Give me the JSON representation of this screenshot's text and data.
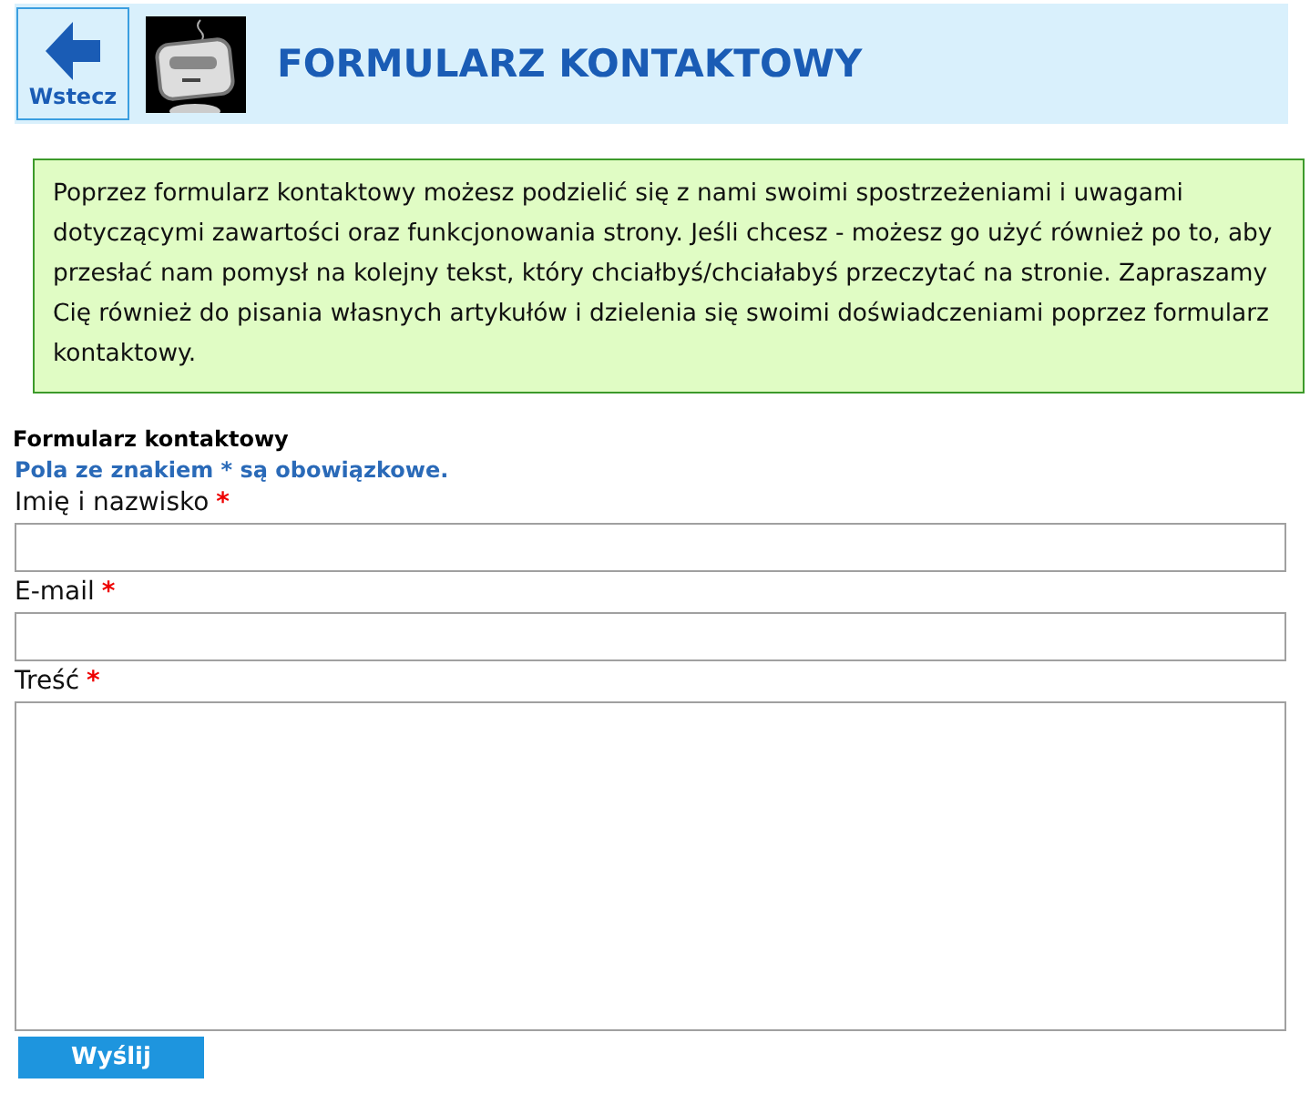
{
  "header": {
    "back_button": "Wstecz",
    "title": "FORMULARZ KONTAKTOWY"
  },
  "intro": "Poprzez formularz kontaktowy możesz podzielić się z nami swoimi spostrzeżeniami i uwagami dotyczącymi zawartości oraz funkcjonowania strony. Jeśli chcesz - możesz go użyć również po to, aby przesłać nam pomysł na kolejny tekst, który chciałbyś/chciałabyś przeczytać na stronie. Zapraszamy Cię również do pisania własnych artykułów i dzielenia się swoimi doświadczeniami poprzez formularz kontaktowy.",
  "form": {
    "heading": "Formularz kontaktowy",
    "note": "Pola ze znakiem * są obowiązkowe.",
    "fields": [
      {
        "label": "Imię i nazwisko",
        "required_mark": "*",
        "kind": "input"
      },
      {
        "label": "E-mail",
        "required_mark": "*",
        "kind": "input"
      },
      {
        "label": "Treść",
        "required_mark": "*",
        "kind": "textarea"
      }
    ],
    "submit": "Wyślij"
  }
}
